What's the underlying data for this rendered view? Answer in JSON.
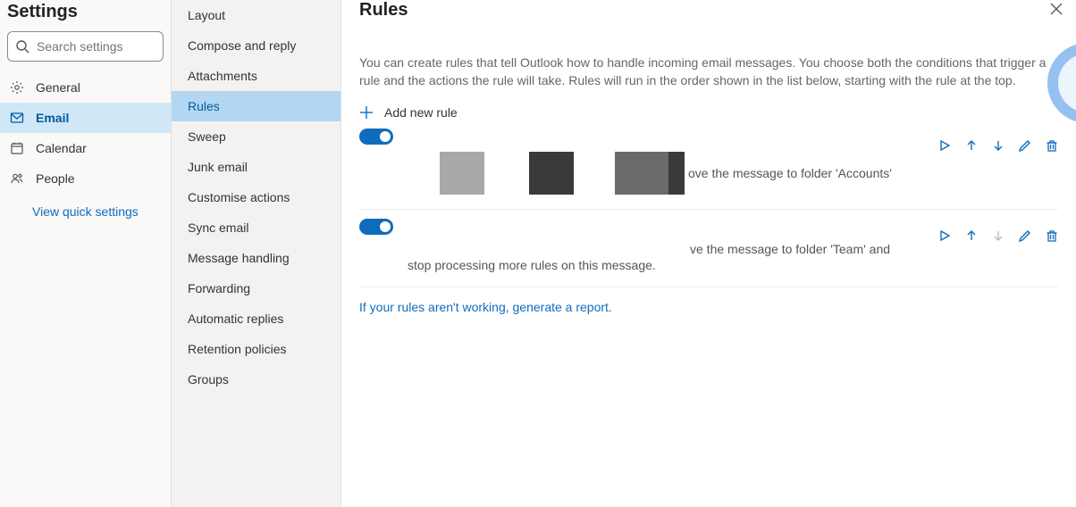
{
  "title": "Settings",
  "search": {
    "placeholder": "Search settings"
  },
  "leftnav": {
    "items": [
      {
        "label": "General"
      },
      {
        "label": "Email"
      },
      {
        "label": "Calendar"
      },
      {
        "label": "People"
      }
    ],
    "quick": "View quick settings"
  },
  "subnav": {
    "items": [
      {
        "label": "Layout"
      },
      {
        "label": "Compose and reply"
      },
      {
        "label": "Attachments"
      },
      {
        "label": "Rules"
      },
      {
        "label": "Sweep"
      },
      {
        "label": "Junk email"
      },
      {
        "label": "Customise actions"
      },
      {
        "label": "Sync email"
      },
      {
        "label": "Message handling"
      },
      {
        "label": "Forwarding"
      },
      {
        "label": "Automatic replies"
      },
      {
        "label": "Retention policies"
      },
      {
        "label": "Groups"
      }
    ]
  },
  "main": {
    "title": "Rules",
    "intro": "You can create rules that tell Outlook how to handle incoming email messages. You choose both the conditions that trigger a rule and the actions the rule will take. Rules will run in the order shown in the list below, starting with the rule at the top.",
    "add": "Add new rule",
    "rule1_fragment": "ove the message to folder 'Accounts'",
    "rule2_fragment_a": "ve the message to folder 'Team' and",
    "rule2_fragment_b": "stop processing more rules on this message.",
    "report": "If your rules aren't working, generate a report."
  }
}
